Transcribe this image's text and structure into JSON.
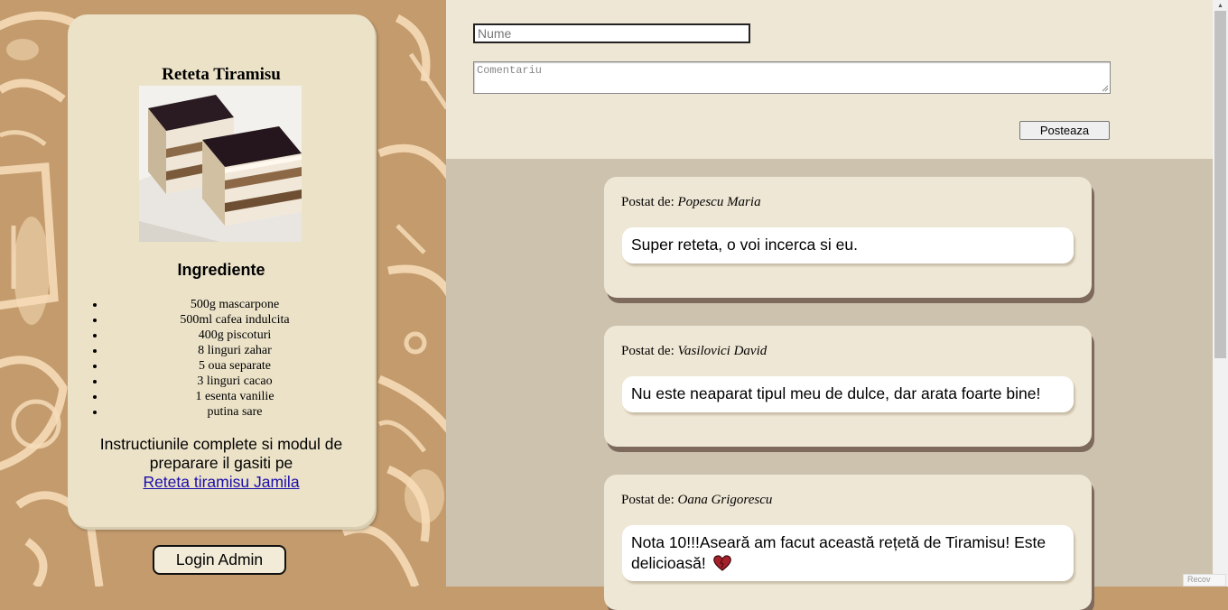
{
  "recipe": {
    "title": "Reteta Tiramisu",
    "ingredients_heading": "Ingrediente",
    "ingredients": [
      "500g mascarpone",
      "500ml cafea indulcita",
      "400g piscoturi",
      "8 linguri zahar",
      "5 oua separate",
      "3 linguri cacao",
      "1 esenta vanilie",
      "putina sare"
    ],
    "instructions_text": "Instructiunile complete si modul de preparare il gasiti pe",
    "link_label": "Reteta tiramisu Jamila"
  },
  "login_button": "Login Admin",
  "form": {
    "name_placeholder": "Nume",
    "comment_placeholder": "Comentariu",
    "submit_label": "Posteaza"
  },
  "comments": [
    {
      "prefix": "Postat de:",
      "author": "Popescu Maria",
      "text": "Super reteta, o voi incerca si eu."
    },
    {
      "prefix": "Postat de:",
      "author": "Vasilovici David",
      "text": "Nu este neaparat tipul meu de dulce, dar arata foarte bine!"
    },
    {
      "prefix": "Postat de:",
      "author": "Oana Grigorescu",
      "text": "Nota 10!!!Aseară am facut această rețetă de Tiramisu! Este delicioasă!",
      "emoji": "heart-icon"
    }
  ],
  "corner_text": "Recov",
  "colors": {
    "left_background": "#c39b6d",
    "card_background": "#ebe2c8",
    "form_background": "#efe7d5",
    "comments_background": "#cdc2ad",
    "comment_shadow": "#7d6a5c"
  }
}
